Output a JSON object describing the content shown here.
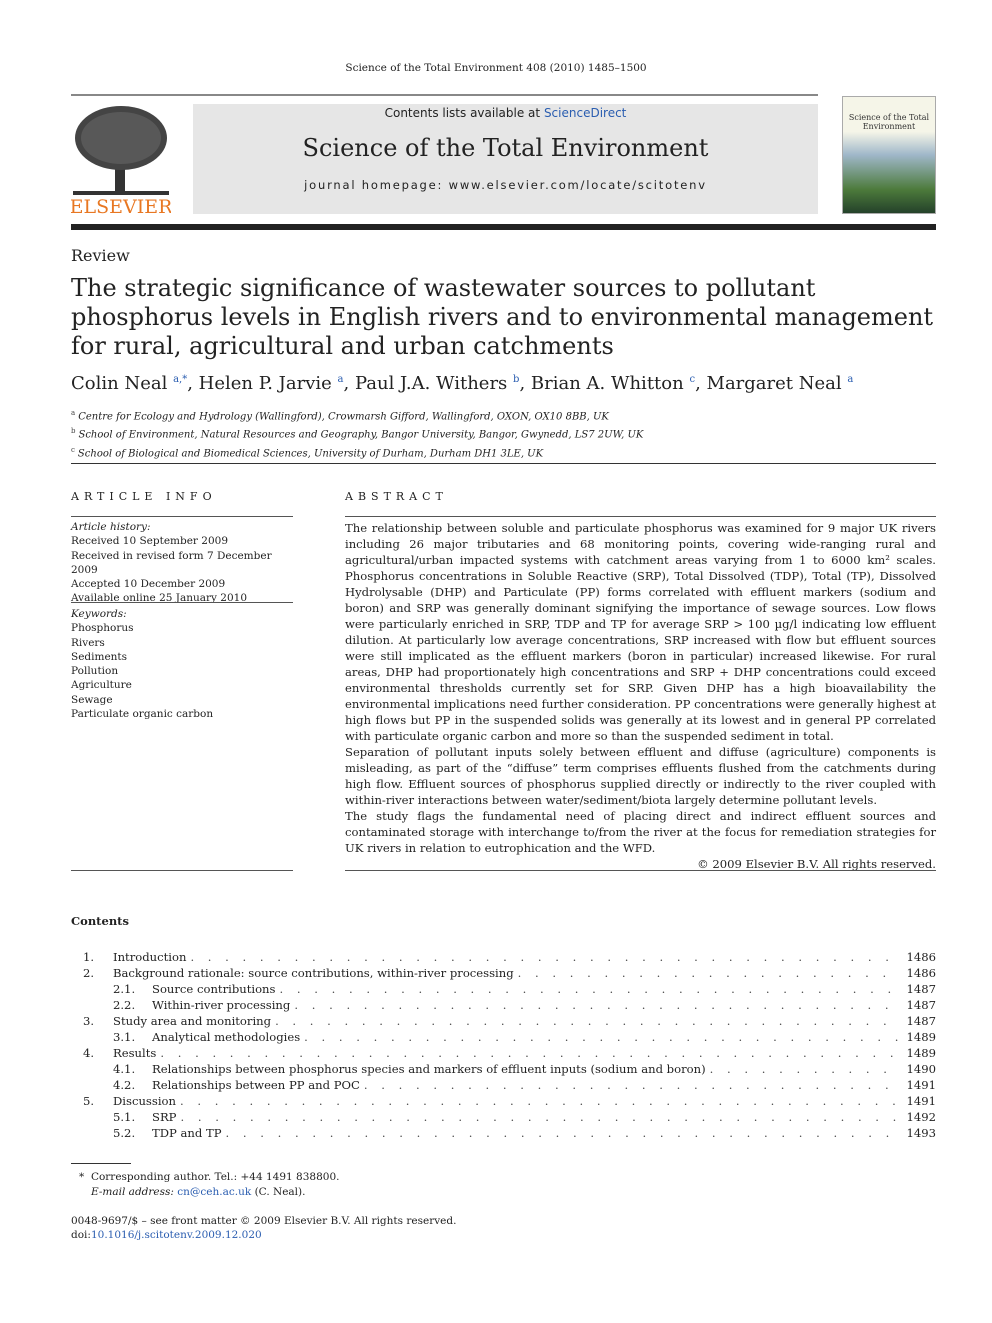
{
  "running_header": "Science of the Total Environment 408 (2010) 1485–1500",
  "banner": {
    "contents_prefix": "Contents lists available at ",
    "contents_link": "ScienceDirect",
    "journal": "Science of the Total Environment",
    "homepage": "journal homepage: www.elsevier.com/locate/scitotenv"
  },
  "publisher_logo": "ELSEVIER",
  "cover": {
    "title": "Science of the Total Environment"
  },
  "article_type": "Review",
  "title": "The strategic significance of wastewater sources to pollutant phosphorus levels in English rivers and to environmental management for rural, agricultural and urban catchments",
  "authors": [
    {
      "name": "Colin Neal",
      "sup": "a,*"
    },
    {
      "name": "Helen P. Jarvie",
      "sup": "a"
    },
    {
      "name": "Paul J.A. Withers",
      "sup": "b"
    },
    {
      "name": "Brian A. Whitton",
      "sup": "c"
    },
    {
      "name": "Margaret Neal",
      "sup": "a"
    }
  ],
  "affiliations": [
    {
      "sup": "a",
      "text": "Centre for Ecology and Hydrology (Wallingford), Crowmarsh Gifford, Wallingford, OXON, OX10 8BB, UK"
    },
    {
      "sup": "b",
      "text": "School of Environment, Natural Resources and Geography, Bangor University, Bangor, Gwynedd, LS7 2UW, UK"
    },
    {
      "sup": "c",
      "text": "School of Biological and Biomedical Sciences, University of Durham, Durham DH1 3LE, UK"
    }
  ],
  "article_info": {
    "heading": "ARTICLE INFO",
    "history_label": "Article history:",
    "history": [
      "Received 10 September 2009",
      "Received in revised form 7 December 2009",
      "Accepted 10 December 2009",
      "Available online 25 January 2010"
    ],
    "keywords_label": "Keywords:",
    "keywords": [
      "Phosphorus",
      "Rivers",
      "Sediments",
      "Pollution",
      "Agriculture",
      "Sewage",
      "Particulate organic carbon"
    ]
  },
  "abstract": {
    "heading": "ABSTRACT",
    "paragraphs": [
      "The relationship between soluble and particulate phosphorus was examined for 9 major UK rivers including 26 major tributaries and 68 monitoring points, covering wide-ranging rural and agricultural/urban impacted systems with catchment areas varying from 1 to 6000 km² scales. Phosphorus concentrations in Soluble Reactive (SRP), Total Dissolved (TDP), Total (TP), Dissolved Hydrolysable (DHP) and Particulate (PP) forms correlated with effluent markers (sodium and boron) and SRP was generally dominant signifying the importance of sewage sources. Low flows were particularly enriched in SRP, TDP and TP for average SRP > 100 µg/l indicating low effluent dilution. At particularly low average concentrations, SRP increased with flow but effluent sources were still implicated as the effluent markers (boron in particular) increased likewise. For rural areas, DHP had proportionately high concentrations and SRP + DHP concentrations could exceed environmental thresholds currently set for SRP. Given DHP has a high bioavailability the environmental implications need further consideration. PP concentrations were generally highest at high flows but PP in the suspended solids was generally at its lowest and in general PP correlated with particulate organic carbon and more so than the suspended sediment in total.",
      "Separation of pollutant inputs solely between effluent and diffuse (agriculture) components is misleading, as part of the “diffuse” term comprises effluents flushed from the catchments during high flow. Effluent sources of phosphorus supplied directly or indirectly to the river coupled with within-river interactions between water/sediment/biota largely determine pollutant levels.",
      "The study flags the fundamental need of placing direct and indirect effluent sources and contaminated storage with interchange to/from the river at the focus for remediation strategies for UK rivers in relation to eutrophication and the WFD."
    ],
    "copyright": "© 2009 Elsevier B.V. All rights reserved."
  },
  "contents": {
    "heading": "Contents",
    "items": [
      {
        "num": "1.",
        "label": "Introduction",
        "page": "1486",
        "level": 1
      },
      {
        "num": "2.",
        "label": "Background rationale: source contributions, within-river processing",
        "page": "1486",
        "level": 1
      },
      {
        "num": "2.1.",
        "label": "Source contributions",
        "page": "1487",
        "level": 2
      },
      {
        "num": "2.2.",
        "label": "Within-river processing",
        "page": "1487",
        "level": 2
      },
      {
        "num": "3.",
        "label": "Study area and monitoring",
        "page": "1487",
        "level": 1
      },
      {
        "num": "3.1.",
        "label": "Analytical methodologies",
        "page": "1489",
        "level": 2
      },
      {
        "num": "4.",
        "label": "Results",
        "page": "1489",
        "level": 1
      },
      {
        "num": "4.1.",
        "label": "Relationships between phosphorus species and markers of effluent inputs (sodium and boron)",
        "page": "1490",
        "level": 2
      },
      {
        "num": "4.2.",
        "label": "Relationships between PP and POC",
        "page": "1491",
        "level": 2
      },
      {
        "num": "5.",
        "label": "Discussion",
        "page": "1491",
        "level": 1
      },
      {
        "num": "5.1.",
        "label": "SRP",
        "page": "1492",
        "level": 2
      },
      {
        "num": "5.2.",
        "label": "TDP and TP",
        "page": "1493",
        "level": 2
      }
    ]
  },
  "footnote": {
    "marker": "*",
    "text": "Corresponding author. Tel.: +44 1491 838800.",
    "email_label": "E-mail address:",
    "email": "cn@ceh.ac.uk",
    "email_suffix": "(C. Neal)."
  },
  "issn": "0048-9697/$ – see front matter © 2009 Elsevier B.V. All rights reserved.",
  "doi_label": "doi:",
  "doi": "10.1016/j.scitotenv.2009.12.020"
}
